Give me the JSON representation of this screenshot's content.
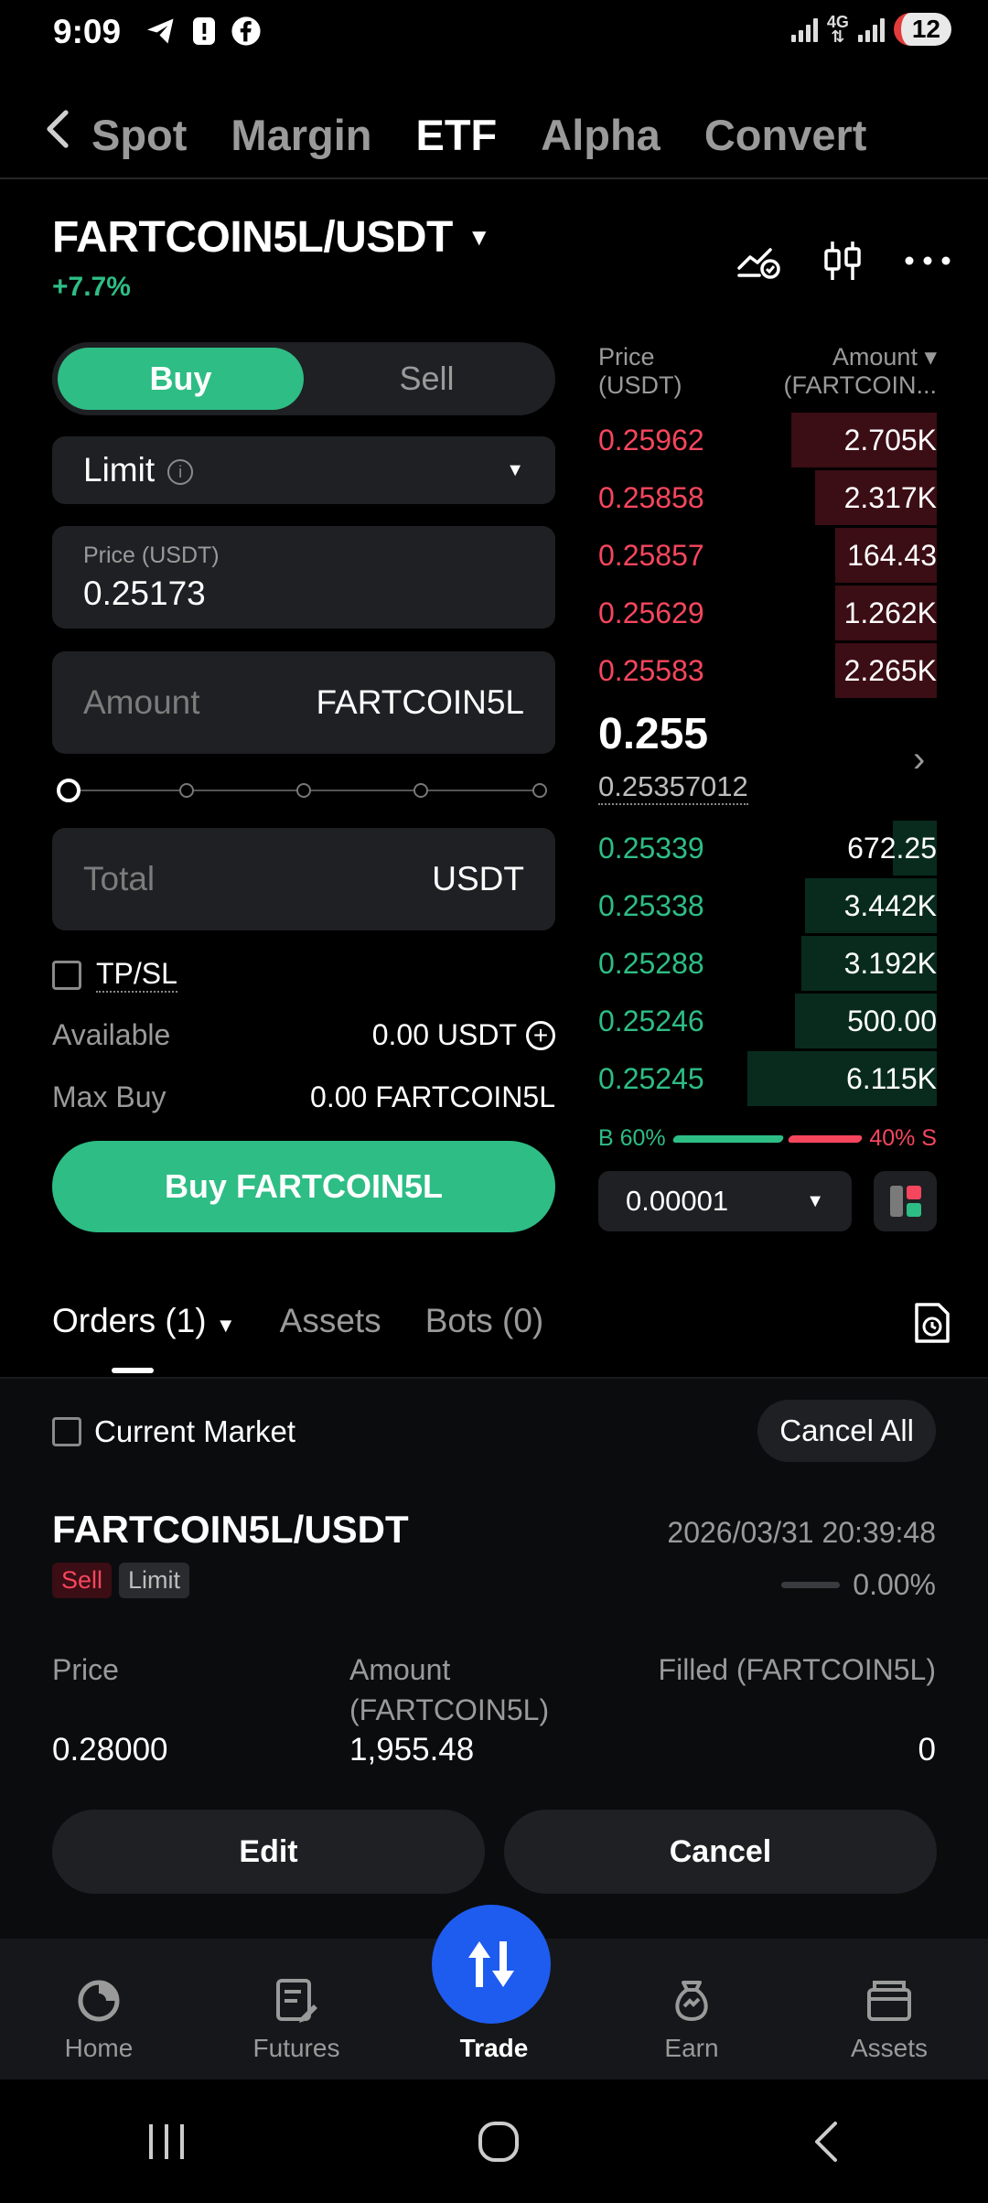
{
  "status_bar": {
    "time": "9:09",
    "network": "4G",
    "notifications": "12"
  },
  "top_tabs": [
    "Spot",
    "Margin",
    "ETF",
    "Alpha",
    "Convert"
  ],
  "top_tabs_active": "ETF",
  "pair": {
    "name": "FARTCOIN5L/USDT",
    "change": "+7.7%"
  },
  "order_form": {
    "buy_label": "Buy",
    "sell_label": "Sell",
    "order_type": "Limit",
    "price_label": "Price (USDT)",
    "price_value": "0.25173",
    "amount_placeholder": "Amount",
    "amount_unit": "FARTCOIN5L",
    "total_placeholder": "Total",
    "total_unit": "USDT",
    "tpsl_label": "TP/SL",
    "available_label": "Available",
    "available_value": "0.00 USDT",
    "maxbuy_label": "Max Buy",
    "maxbuy_value": "0.00 FARTCOIN5L",
    "submit_label": "Buy FARTCOIN5L"
  },
  "orderbook": {
    "price_header_1": "Price",
    "price_header_2": "(USDT)",
    "amount_header_1": "Amount ▾",
    "amount_header_2": "(FARTCOIN...",
    "asks": [
      {
        "price": "0.25962",
        "amount": "2.705K",
        "depth": 0.43
      },
      {
        "price": "0.25858",
        "amount": "2.317K",
        "depth": 0.36
      },
      {
        "price": "0.25857",
        "amount": "164.43",
        "depth": 0.3
      },
      {
        "price": "0.25629",
        "amount": "1.262K",
        "depth": 0.3
      },
      {
        "price": "0.25583",
        "amount": "2.265K",
        "depth": 0.3
      }
    ],
    "last_price": "0.255",
    "mark_price": "0.25357012",
    "bids": [
      {
        "price": "0.25339",
        "amount": "672.25",
        "depth": 0.13
      },
      {
        "price": "0.25338",
        "amount": "3.442K",
        "depth": 0.39
      },
      {
        "price": "0.25288",
        "amount": "3.192K",
        "depth": 0.4
      },
      {
        "price": "0.25246",
        "amount": "500.00",
        "depth": 0.42
      },
      {
        "price": "0.25245",
        "amount": "6.115K",
        "depth": 0.56
      }
    ],
    "buy_ratio_label": "B 60%",
    "sell_ratio_label": "40% S",
    "buy_ratio": 0.6,
    "precision": "0.00001"
  },
  "orders_tabs": {
    "orders": "Orders (1)",
    "assets": "Assets",
    "bots": "Bots (0)"
  },
  "orders": {
    "current_market_label": "Current Market",
    "cancel_all_label": "Cancel All",
    "item": {
      "pair": "FARTCOIN5L/USDT",
      "time": "2026/03/31 20:39:48",
      "side": "Sell",
      "type": "Limit",
      "filled_pct": "0.00%",
      "price_label": "Price",
      "amount_label_1": "Amount",
      "amount_label_2": "(FARTCOIN5L)",
      "filled_label": "Filled (FARTCOIN5L)",
      "price": "0.28000",
      "amount": "1,955.48",
      "filled": "0",
      "edit_label": "Edit",
      "cancel_label": "Cancel"
    }
  },
  "bottom_nav": {
    "home": "Home",
    "futures": "Futures",
    "trade": "Trade",
    "earn": "Earn",
    "assets": "Assets"
  },
  "colors": {
    "green": "#2ebd85",
    "red": "#f6465d",
    "fab_blue": "#1e5cf0"
  }
}
